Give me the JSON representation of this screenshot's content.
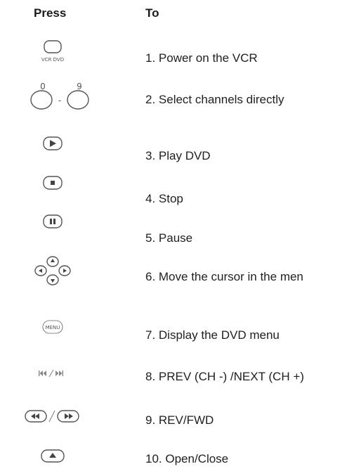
{
  "headers": {
    "press": "Press",
    "to": "To"
  },
  "rows": [
    {
      "label": "1. Power on the VCR",
      "icon": "power-vcr-dvd-button-icon",
      "icon_text": "VCR DVD"
    },
    {
      "label": "2. Select channels directly",
      "icon": "number-buttons-icon",
      "icon_text_start": "0",
      "icon_text_dash": "-",
      "icon_text_end": "9"
    },
    {
      "label": "3. Play DVD",
      "icon": "play-button-icon"
    },
    {
      "label": "4. Stop",
      "icon": "stop-button-icon"
    },
    {
      "label": "5. Pause",
      "icon": "pause-button-icon"
    },
    {
      "label": "6. Move the cursor in the men",
      "icon": "direction-pad-icon"
    },
    {
      "label": "7. Display the DVD menu",
      "icon": "menu-button-icon",
      "icon_text": "MENU"
    },
    {
      "label": "8. PREV (CH -) /NEXT (CH +)",
      "icon": "prev-next-buttons-icon"
    },
    {
      "label": "9. REV/FWD",
      "icon": "rev-fwd-buttons-icon"
    },
    {
      "label": "10. Open/Close",
      "icon": "open-close-button-icon"
    }
  ]
}
